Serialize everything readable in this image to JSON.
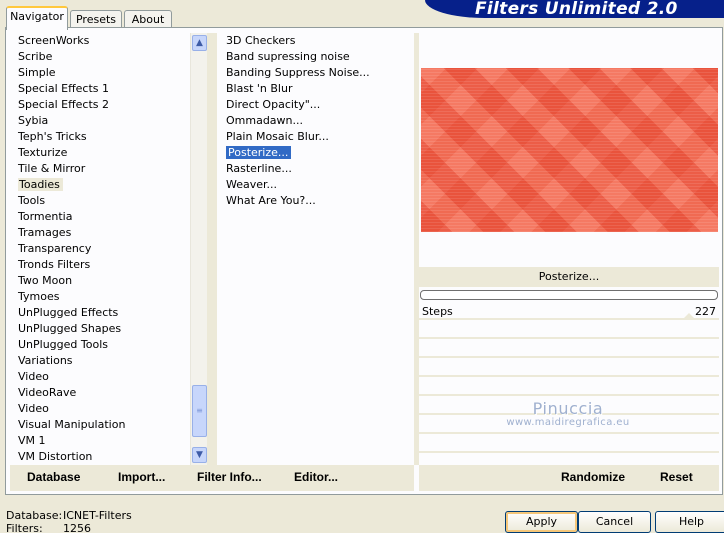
{
  "tabs": [
    {
      "label": "Navigator",
      "active": true
    },
    {
      "label": "Presets",
      "active": false
    },
    {
      "label": "About",
      "active": false
    }
  ],
  "banner": {
    "title": "Filters Unlimited 2.0"
  },
  "categories": {
    "selected": "Toadies",
    "items": [
      "ScreenWorks",
      "Scribe",
      "Simple",
      "Special Effects 1",
      "Special Effects 2",
      "Sybia",
      "Teph's Tricks",
      "Texturize",
      "Tile & Mirror",
      "Toadies",
      "Tools",
      "Tormentia",
      "Tramages",
      "Transparency",
      "Tronds Filters",
      "Two Moon",
      "Tymoes",
      "UnPlugged Effects",
      "UnPlugged Shapes",
      "UnPlugged Tools",
      "Variations",
      "Video",
      "VideoRave",
      "Video",
      "Visual Manipulation",
      "VM 1",
      "VM Distortion"
    ]
  },
  "filters": {
    "selected": "Posterize...",
    "items": [
      "3D Checkers",
      "Band supressing noise",
      "Banding Suppress Noise...",
      "Blast 'n Blur",
      "Direct Opacity\"...",
      "Ommadawn...",
      "Plain Mosaic Blur...",
      "Posterize...",
      "Rasterline...",
      "Weaver...",
      "What Are You?..."
    ]
  },
  "preview": {
    "filter_name": "Posterize...",
    "progress": 0
  },
  "params": [
    {
      "label": "Steps",
      "value": "227"
    }
  ],
  "watermark": {
    "name": "Pinuccia",
    "url": "www.maidiregrafica.eu"
  },
  "left_buttons": {
    "database": "Database",
    "import": "Import...",
    "filter_info": "Filter Info...",
    "editor": "Editor..."
  },
  "right_buttons": {
    "randomize": "Randomize",
    "reset": "Reset"
  },
  "footer": {
    "database_label": "Database:",
    "database_value": "ICNET-Filters",
    "filters_label": "Filters:",
    "filters_value": "1256",
    "apply": "Apply",
    "cancel": "Cancel",
    "help": "Help"
  },
  "icons": {
    "scroll_up": "chevron-up-icon",
    "scroll_down": "chevron-down-icon",
    "grip": "grip-icon"
  }
}
